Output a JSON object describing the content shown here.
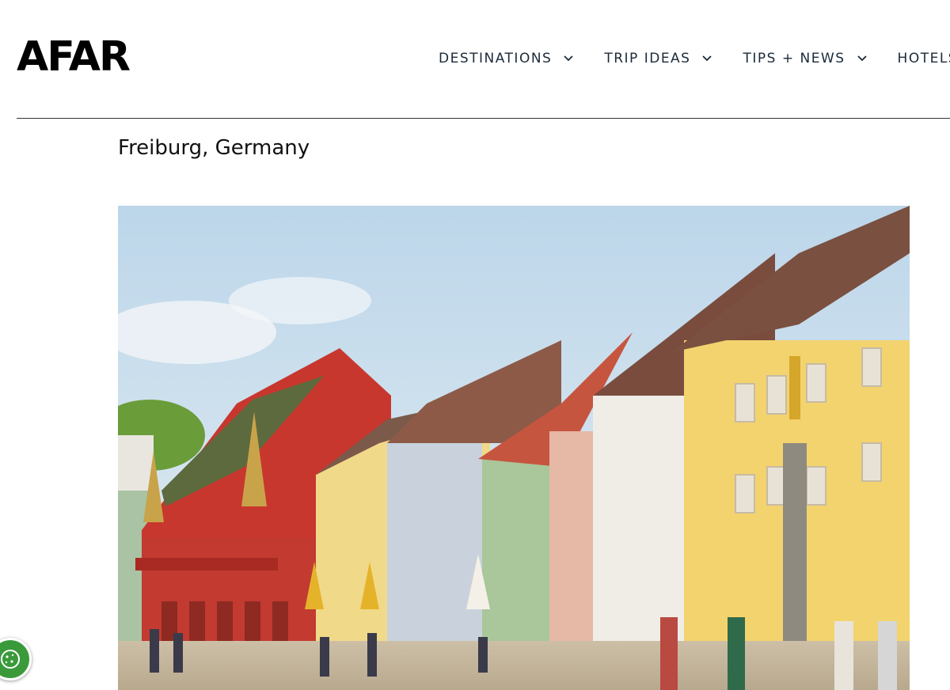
{
  "brand": {
    "logo_text": "AFAR"
  },
  "nav": {
    "items": [
      {
        "label": "DESTINATIONS",
        "icon": "chevron-down-icon"
      },
      {
        "label": "TRIP IDEAS",
        "icon": "chevron-down-icon"
      },
      {
        "label": "TIPS + NEWS",
        "icon": "chevron-down-icon"
      },
      {
        "label": "HOTELS",
        "icon": ""
      }
    ]
  },
  "page": {
    "title": "Freiburg, Germany"
  },
  "hero": {
    "subject": "Colorful historic buildings on Münsterplatz with red merchants' hall and fountain"
  },
  "cookie": {
    "icon": "cookie-icon",
    "color": "#3a9a3a"
  },
  "colors": {
    "accent_nav": "#1a2a3a",
    "divider": "#333333"
  }
}
